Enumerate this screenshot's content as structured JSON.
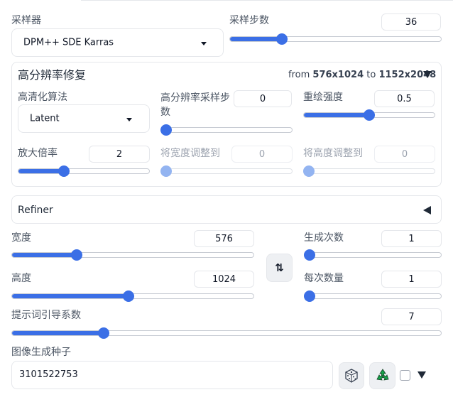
{
  "sampler": {
    "label": "采样器",
    "value": "DPM++ SDE Karras"
  },
  "steps": {
    "label": "采样步数",
    "value": "36",
    "level": 0.24
  },
  "hires": {
    "title": "高分辨率修复",
    "from_prefix": "from",
    "from_value": "576x1024",
    "to_prefix": "to",
    "to_value": "1152x2048",
    "upscaler_label": "高清化算法",
    "upscaler_value": "Latent",
    "hires_steps_label": "高分辨率采样步数",
    "hires_steps_value": "0",
    "hires_steps_level": 0.0,
    "denoise_label": "重绘强度",
    "denoise_value": "0.5",
    "denoise_level": 0.5,
    "scale_label": "放大倍率",
    "scale_value": "2",
    "scale_level": 0.33,
    "resize_w_label": "将宽度调整到",
    "resize_w_value": "0",
    "resize_h_label": "将高度调整到",
    "resize_h_value": "0"
  },
  "refiner": {
    "label": "Refiner"
  },
  "width": {
    "label": "宽度",
    "value": "576",
    "level": 0.27
  },
  "height": {
    "label": "高度",
    "value": "1024",
    "level": 0.48
  },
  "batch_count": {
    "label": "生成次数",
    "value": "1",
    "level": 0.0
  },
  "batch_size": {
    "label": "每次数量",
    "value": "1",
    "level": 0.0
  },
  "cfg": {
    "label": "提示词引导系数",
    "value": "7",
    "level": 0.21
  },
  "seed": {
    "label": "图像生成种子",
    "value": "3101522753"
  },
  "colors": {
    "accent": "#3b6fe6",
    "border": "#e5e7eb",
    "recycle": "#16a34a"
  }
}
